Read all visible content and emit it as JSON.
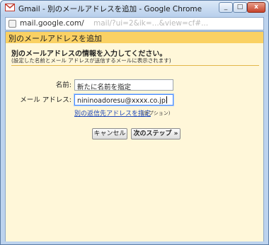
{
  "window": {
    "title": "Gmail - 別のメールアドレスを追加 - Google Chrome",
    "controls": {
      "minimize": "_",
      "maximize": "□",
      "close": "x"
    }
  },
  "address_bar": {
    "url_visible": "mail.google.com/",
    "url_tail_blurred": "mail/?ui=2&ik=...&view=cf#...",
    "icon": "page-icon"
  },
  "dialog": {
    "header_title": "別のメールアドレスを追加",
    "heading": "別のメールアドレスの情報を入力してください。",
    "subnote": "(設定した名前とメール アドレスが送信するメールに表示されます)",
    "form": {
      "name_label": "名前:",
      "name_value": "新たに名前を指定",
      "email_label": "メール アドレス:",
      "email_value": "nininoadoresu@xxxx.co.jp",
      "reply_link": "別の返信先アドレスを指定",
      "reply_optional": "(オプション)"
    },
    "buttons": {
      "cancel": "キャンセル",
      "next": "次のステップ »"
    }
  },
  "colors": {
    "header_band": "#fad163",
    "section_bg": "#fff7d9",
    "link": "#1a44b8",
    "frame": "#bcd3ee"
  }
}
